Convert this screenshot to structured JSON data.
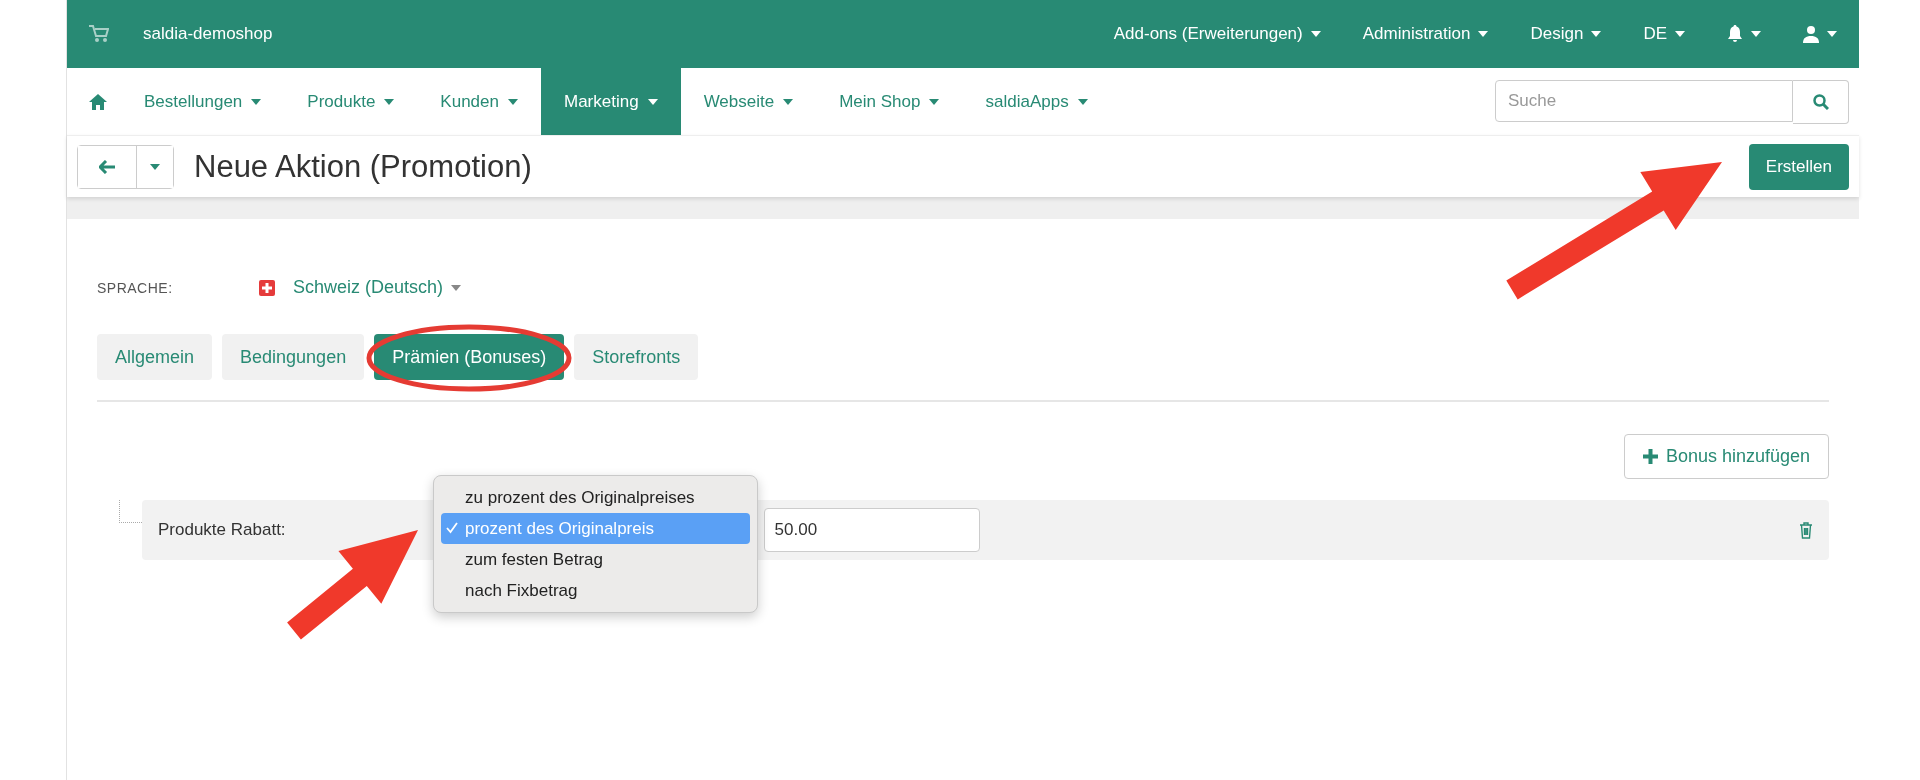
{
  "shop": {
    "name": "saldia-demoshop"
  },
  "top_menu": [
    {
      "label": "Add-ons (Erweiterungen)"
    },
    {
      "label": "Administration"
    },
    {
      "label": "Design"
    },
    {
      "label": "DE"
    }
  ],
  "nav": [
    {
      "label": "Bestellungen",
      "selected": false
    },
    {
      "label": "Produkte",
      "selected": false
    },
    {
      "label": "Kunden",
      "selected": false
    },
    {
      "label": "Marketing",
      "selected": true
    },
    {
      "label": "Webseite",
      "selected": false
    },
    {
      "label": "Mein Shop",
      "selected": false
    },
    {
      "label": "saldiaApps",
      "selected": false
    }
  ],
  "search": {
    "placeholder": "Suche"
  },
  "page": {
    "title": "Neue Aktion (Promotion)",
    "create_button": "Erstellen"
  },
  "language": {
    "label": "SPRACHE:",
    "value": "Schweiz (Deutsch)"
  },
  "tabs": [
    {
      "label": "Allgemein",
      "selected": false
    },
    {
      "label": "Bedingungen",
      "selected": false
    },
    {
      "label": "Prämien (Bonuses)",
      "selected": true
    },
    {
      "label": "Storefronts",
      "selected": false
    }
  ],
  "add_bonus_button": "Bonus hinzufügen",
  "bonuses": [
    {
      "label": "Produkte Rabatt:",
      "value": "50.00"
    }
  ],
  "dropdown": {
    "options": [
      {
        "label": "zu prozent des Originalpreises",
        "selected": false
      },
      {
        "label": "prozent des Originalpreis",
        "selected": true
      },
      {
        "label": "zum festen Betrag",
        "selected": false
      },
      {
        "label": "nach Fixbetrag",
        "selected": false
      }
    ]
  }
}
